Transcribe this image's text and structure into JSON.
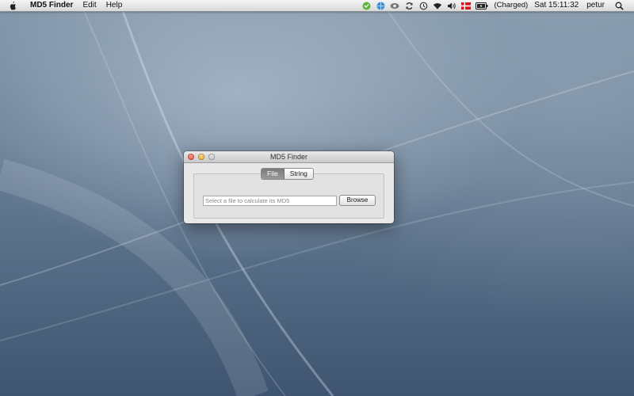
{
  "menubar": {
    "apple_icon": "apple-icon",
    "app_name": "MD5 Finder",
    "menus": [
      "Edit",
      "Help"
    ],
    "status": {
      "battery_text": "(Charged)",
      "clock": "Sat 15:11:32",
      "user": "petur"
    }
  },
  "window": {
    "title": "MD5 Finder",
    "tabs": [
      {
        "label": "File",
        "selected": true
      },
      {
        "label": "String",
        "selected": false
      }
    ],
    "file_field": {
      "value": "",
      "placeholder": "Select a file to calculate its MD5"
    },
    "browse_label": "Browse"
  },
  "colors": {
    "close": "#d8402e",
    "minimize": "#d99a1e",
    "selected_tab": "#8a8a8a"
  }
}
